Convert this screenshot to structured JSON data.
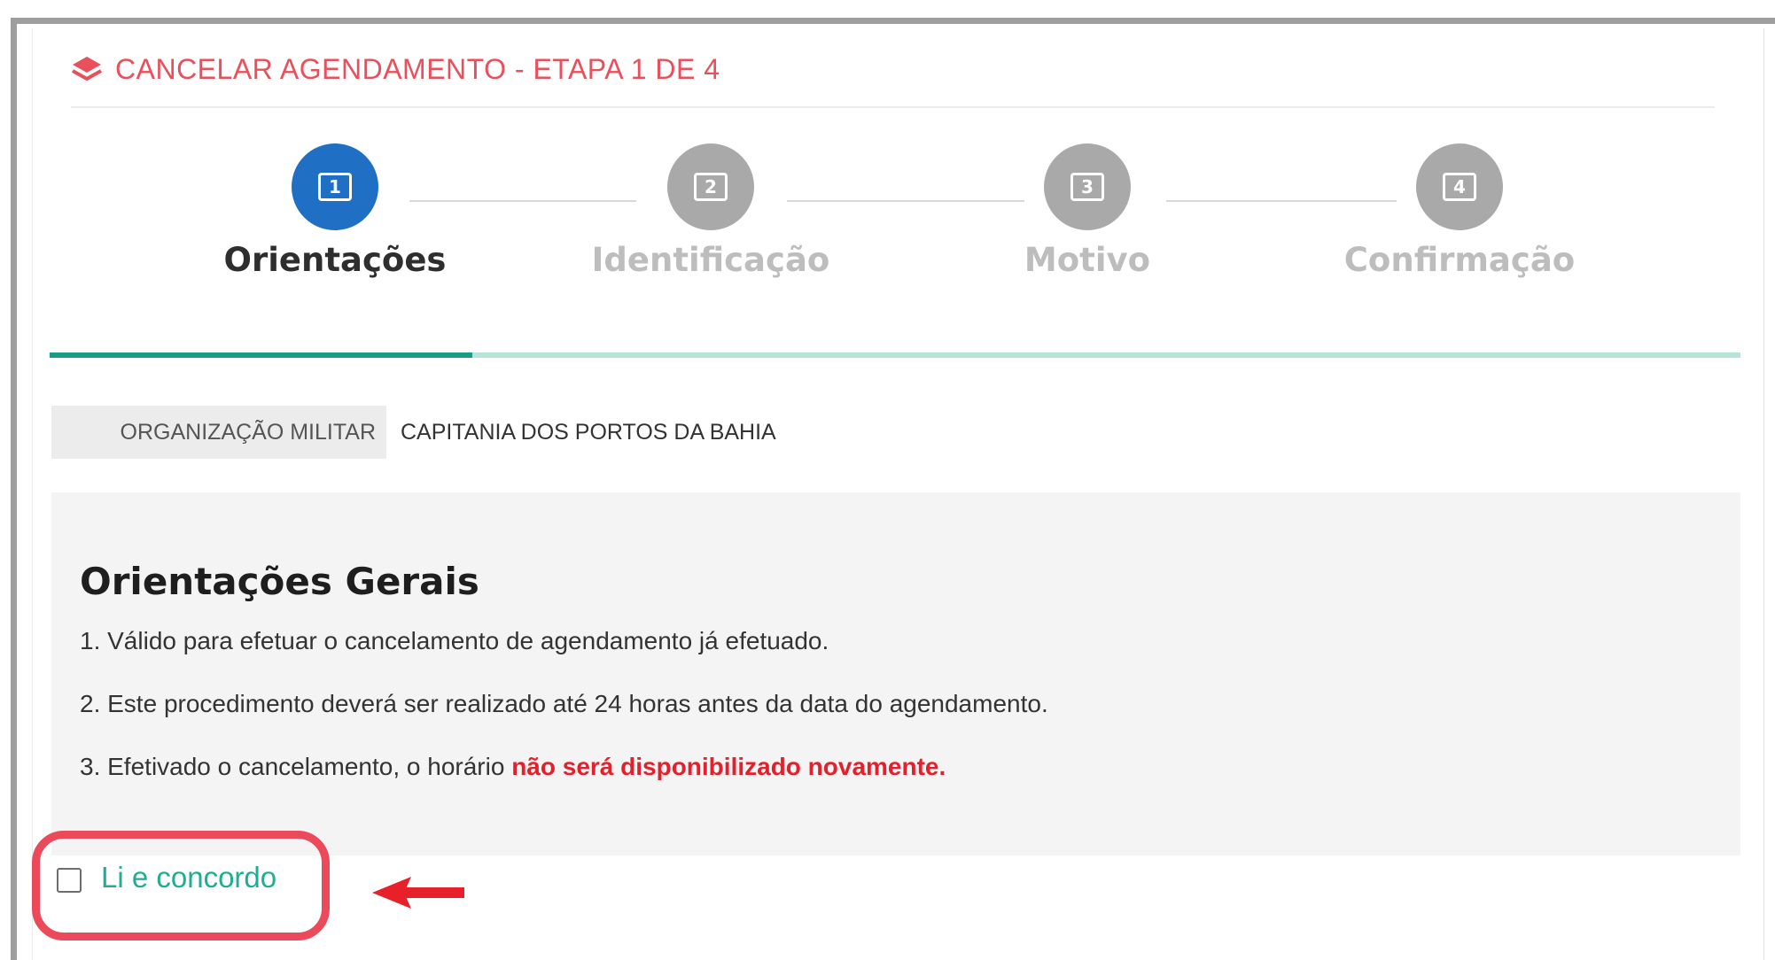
{
  "header": {
    "title": "CANCELAR AGENDAMENTO - ETAPA 1 DE 4",
    "icon": "layers-icon",
    "accent_color": "#e8505b"
  },
  "stepper": {
    "steps": [
      {
        "number": "1",
        "label": "Orientações",
        "state": "active"
      },
      {
        "number": "2",
        "label": "Identificação",
        "state": "inactive"
      },
      {
        "number": "3",
        "label": "Motivo",
        "state": "inactive"
      },
      {
        "number": "4",
        "label": "Confirmação",
        "state": "inactive"
      }
    ],
    "active_color": "#1f6fc4",
    "inactive_color": "#a9a9a9"
  },
  "progress": {
    "fraction": 0.25,
    "fill_color": "#1a9c84",
    "track_color": "#b8e4d8"
  },
  "organization": {
    "label": "ORGANIZAÇÃO MILITAR",
    "value": "CAPITANIA DOS PORTOS DA BAHIA"
  },
  "guidelines": {
    "title": "Orientações Gerais",
    "items": [
      "1. Válido para efetuar o cancelamento de agendamento já efetuado.",
      "2. Este procedimento deverá ser realizado até 24 horas antes da data do agendamento."
    ],
    "item3_prefix": "3. Efetivado o cancelamento, o horário ",
    "item3_warning": "não será disponibilizado novamente.",
    "warning_color": "#e3202b"
  },
  "agreement": {
    "label": "Li e concordo",
    "checked": false,
    "highlight_color": "#ec4a5a"
  }
}
